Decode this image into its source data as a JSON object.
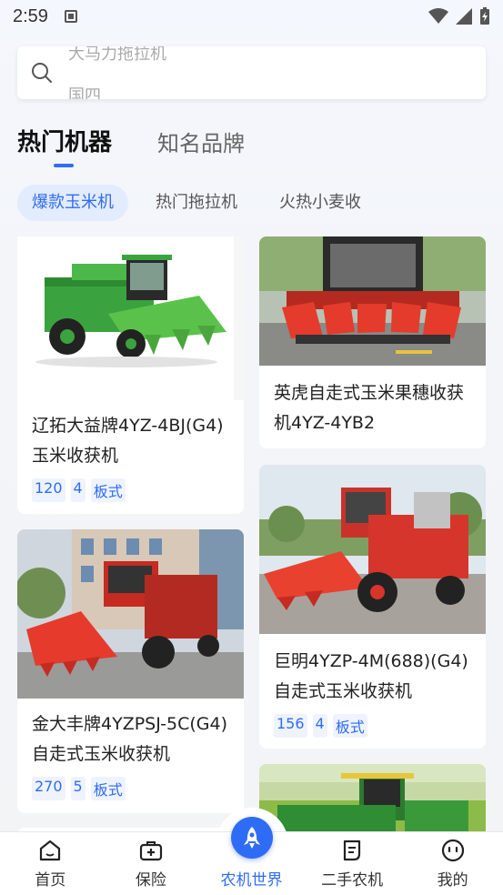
{
  "status_bar": {
    "time": "2:59"
  },
  "search": {
    "placeholder_top": "大马力拖拉机",
    "placeholder_bottom": "国四"
  },
  "main_tabs": [
    {
      "label": "热门机器",
      "active": true
    },
    {
      "label": "知名品牌",
      "active": false
    }
  ],
  "sub_tabs": [
    {
      "label": "爆款玉米机",
      "active": true
    },
    {
      "label": "热门拖拉机",
      "active": false
    },
    {
      "label": "火热小麦收",
      "active": false
    }
  ],
  "cards": [
    {
      "title": "辽拓大益牌4YZ-4BJ(G4)玉米收获机",
      "tags": [
        "120",
        "4",
        "板式"
      ],
      "image": "green-corn-harvester"
    },
    {
      "title": "英虎自走式玉米果穗收获机4YZ-4YB2",
      "tags": [],
      "image": "red-corn-header"
    },
    {
      "title": "金大丰牌4YZPSJ-5C(G4)自走式玉米收获机",
      "tags": [
        "270",
        "5",
        "板式"
      ],
      "image": "red-corn-harvester"
    },
    {
      "title": "巨明4YZP-4M(688)(G4)自走式玉米收获机",
      "tags": [
        "156",
        "4",
        "板式"
      ],
      "image": "red-corn-harvester-side"
    },
    {
      "title": "",
      "tags": [],
      "image": "green-harvester-field"
    }
  ],
  "bottom_nav": [
    {
      "label": "首页",
      "icon": "home-icon",
      "active": false
    },
    {
      "label": "保险",
      "icon": "insurance-kit-icon",
      "active": false
    },
    {
      "label": "农机世界",
      "icon": "rocket-icon",
      "active": true
    },
    {
      "label": "二手农机",
      "icon": "used-machinery-icon",
      "active": false
    },
    {
      "label": "我的",
      "icon": "profile-face-icon",
      "active": false
    }
  ],
  "colors": {
    "accent": "#2f6cf6",
    "chip_bg": "#e3ecfd"
  }
}
